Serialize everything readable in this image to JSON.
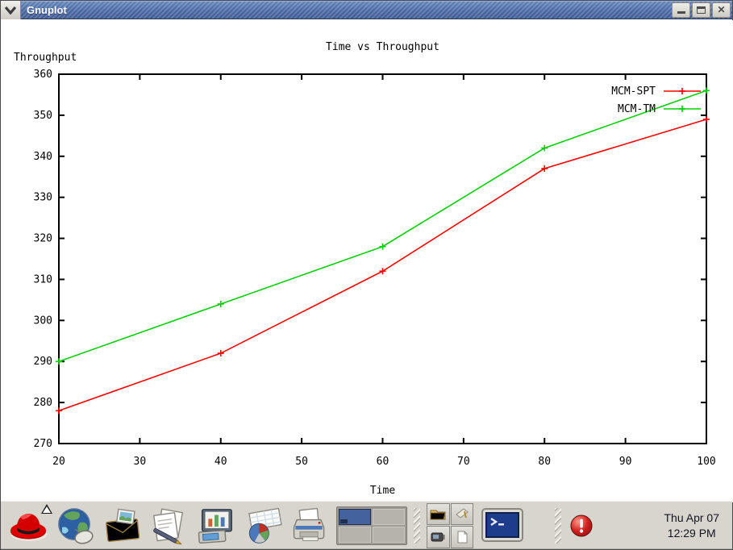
{
  "window": {
    "title": "Gnuplot",
    "controls": {
      "close_glyph": "✕"
    }
  },
  "chart_data": {
    "type": "line",
    "title": "Time vs Throughput",
    "xlabel": "Time",
    "ylabel": "Throughput",
    "xlim": [
      20,
      100
    ],
    "ylim": [
      270,
      360
    ],
    "xticks": [
      20,
      30,
      40,
      50,
      60,
      70,
      80,
      90,
      100
    ],
    "yticks": [
      270,
      280,
      290,
      300,
      310,
      320,
      330,
      340,
      350,
      360
    ],
    "grid": false,
    "legend_position": "top-right-inside",
    "x": [
      20,
      40,
      60,
      80,
      100
    ],
    "series": [
      {
        "name": "MCM-SPT",
        "color": "#ff0000",
        "marker": "plus",
        "values": [
          278,
          292,
          312,
          337,
          349
        ]
      },
      {
        "name": "MCM-TM",
        "color": "#00d000",
        "marker": "plus",
        "values": [
          290,
          304,
          318,
          342,
          356
        ]
      }
    ]
  },
  "taskbar": {
    "icons": {
      "main_menu": "red-hat-fedora-icon",
      "launcher_2": "web-browser-globe-icon",
      "launcher_3": "email-envelope-icon",
      "launcher_4": "word-processor-icon",
      "launcher_5": "presentation-icon",
      "launcher_6": "spreadsheet-piechart-icon",
      "launcher_7": "printer-icon",
      "pager": "workspace-switcher",
      "drawer_1": "folder-icon",
      "drawer_2": "utility-icon",
      "drawer_3": "device-icon",
      "drawer_4": "document-icon",
      "terminal": "terminal-icon",
      "alert": "alert-notification-icon"
    },
    "clock": {
      "date": "Thu Apr 07",
      "time": "12:29 PM"
    }
  }
}
